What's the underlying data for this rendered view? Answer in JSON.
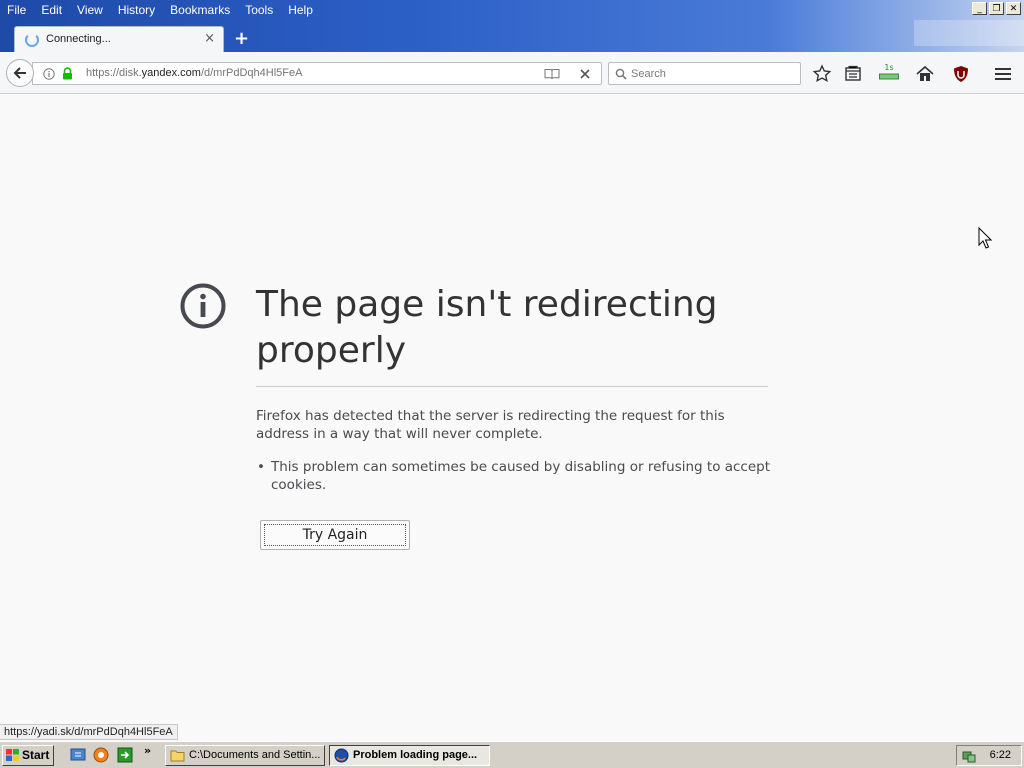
{
  "menu": [
    "File",
    "Edit",
    "View",
    "History",
    "Bookmarks",
    "Tools",
    "Help"
  ],
  "window_controls": {
    "minimize": "_",
    "restore": "❐",
    "close": "✕"
  },
  "tab": {
    "title": "Connecting...",
    "close": "×",
    "new_tab": "+"
  },
  "navbar": {
    "url_prefix": "https://disk.",
    "url_host": "yandex.com",
    "url_path": "/d/mrPdDqh4Hl5FeA",
    "search_placeholder": "Search",
    "ext_badge": "1s"
  },
  "error": {
    "title": "The page isn't redirecting properly",
    "description": "Firefox has detected that the server is redirecting the request for this address in a way that will never complete.",
    "bullet": "This problem can sometimes be caused by disabling or refusing to accept cookies.",
    "button": "Try Again"
  },
  "status_url": "https://yadi.sk/d/mrPdDqh4Hl5FeA",
  "taskbar": {
    "start": "Start",
    "more": "»",
    "tasks": [
      {
        "label": "C:\\Documents and Settin...",
        "active": false
      },
      {
        "label": "Problem loading page...",
        "active": true
      }
    ],
    "clock": "6:22"
  },
  "colors": {
    "titlebar": "#2c5fc6",
    "page_bg": "#f9f9fa",
    "title_text": "#333333",
    "body_text": "#4a4a4f"
  }
}
